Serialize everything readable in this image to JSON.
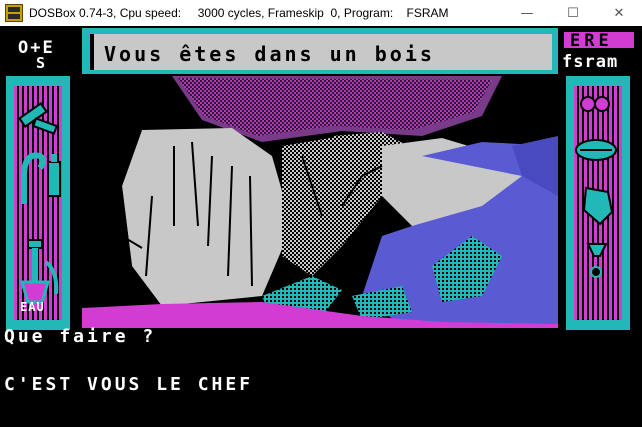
{
  "window": {
    "title": "DOSBox 0.74-3, Cpu speed:     3000 cycles, Frameskip  0, Program:    FSRAM",
    "icon": "dosbox-icon",
    "minimize": "—",
    "maximize": "☐",
    "close": "✕"
  },
  "game": {
    "compass": {
      "row1": "O+E",
      "row2": "S"
    },
    "location": "Vous êtes dans un bois",
    "logo": {
      "top": "ERE",
      "bottom": "fsram"
    },
    "left_panel_label": "EAU",
    "prompt": "Que faire ?",
    "response": "C'EST VOUS LE CHEF",
    "colors": {
      "cyan": "#22b8b8",
      "magenta": "#d23cd2",
      "white": "#ffffff",
      "black": "#000000",
      "grey": "#c8c8c8"
    },
    "left_inventory_icons": [
      "hammer-icon",
      "cane-icon",
      "bottle-icon",
      "shovel-icon"
    ],
    "right_inventory_icons": [
      "fruit-icon",
      "leaf-icon",
      "pine-cone-icon",
      "gem-icon",
      "seed-icon"
    ]
  }
}
